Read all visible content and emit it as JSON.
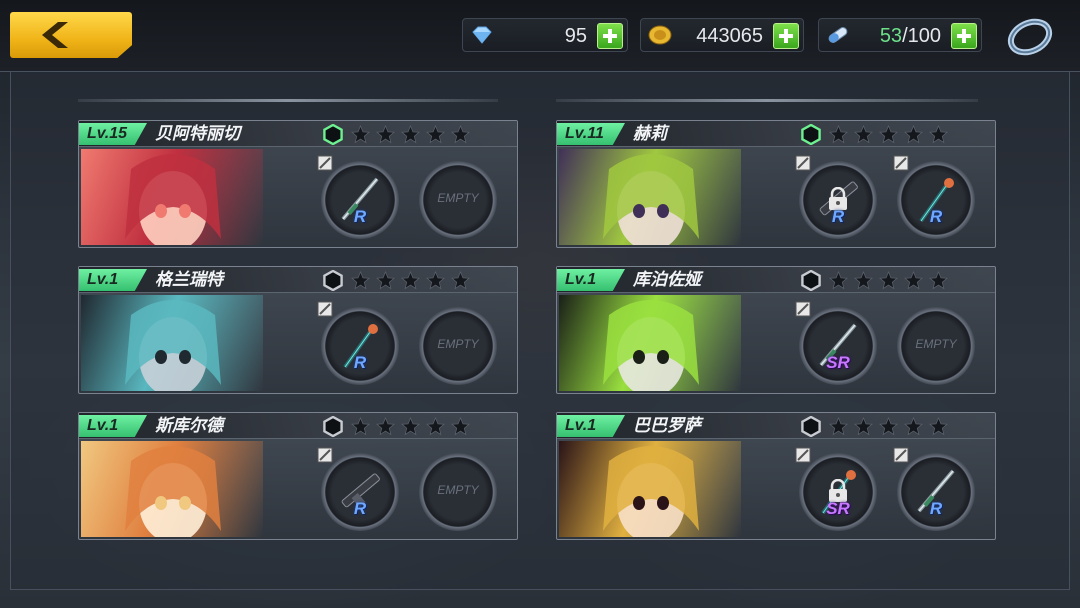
{
  "resources": {
    "diamond": {
      "value": "95",
      "icon": "diamond-icon"
    },
    "gold": {
      "value": "443065",
      "icon": "gold-coin-icon"
    },
    "stamina": {
      "current": "53",
      "max": "/100",
      "icon": "stamina-pill-icon"
    }
  },
  "slot_texts": {
    "empty": "EMPTY"
  },
  "characters": [
    {
      "level": "Lv.15",
      "name": "贝阿特丽切",
      "rank_active": true,
      "stars": 5,
      "slot1": {
        "grade": "R",
        "locked": false
      },
      "slot2": {
        "grade": "",
        "empty": true
      }
    },
    {
      "level": "Lv.11",
      "name": "赫莉",
      "rank_active": true,
      "stars": 5,
      "slot1": {
        "grade": "R",
        "locked": true
      },
      "slot2": {
        "grade": "R",
        "locked": false
      }
    },
    {
      "level": "Lv.1",
      "name": "格兰瑞特",
      "rank_active": false,
      "stars": 5,
      "slot1": {
        "grade": "R",
        "locked": false
      },
      "slot2": {
        "grade": "",
        "empty": true
      }
    },
    {
      "level": "Lv.1",
      "name": "库泊佐娅",
      "rank_active": false,
      "stars": 5,
      "slot1": {
        "grade": "SR",
        "locked": false
      },
      "slot2": {
        "grade": "",
        "empty": true
      }
    },
    {
      "level": "Lv.1",
      "name": "斯库尔德",
      "rank_active": false,
      "stars": 5,
      "slot1": {
        "grade": "R",
        "locked": false
      },
      "slot2": {
        "grade": "",
        "empty": true
      }
    },
    {
      "level": "Lv.1",
      "name": "巴巴罗萨",
      "rank_active": false,
      "stars": 5,
      "slot1": {
        "grade": "SR",
        "locked": true
      },
      "slot2": {
        "grade": "R",
        "locked": false
      }
    }
  ],
  "colors": {
    "accent_green": "#35c070",
    "back_button": "#f0b418",
    "r_grade": "#6fa8ff",
    "sr_grade": "#c778ff"
  }
}
